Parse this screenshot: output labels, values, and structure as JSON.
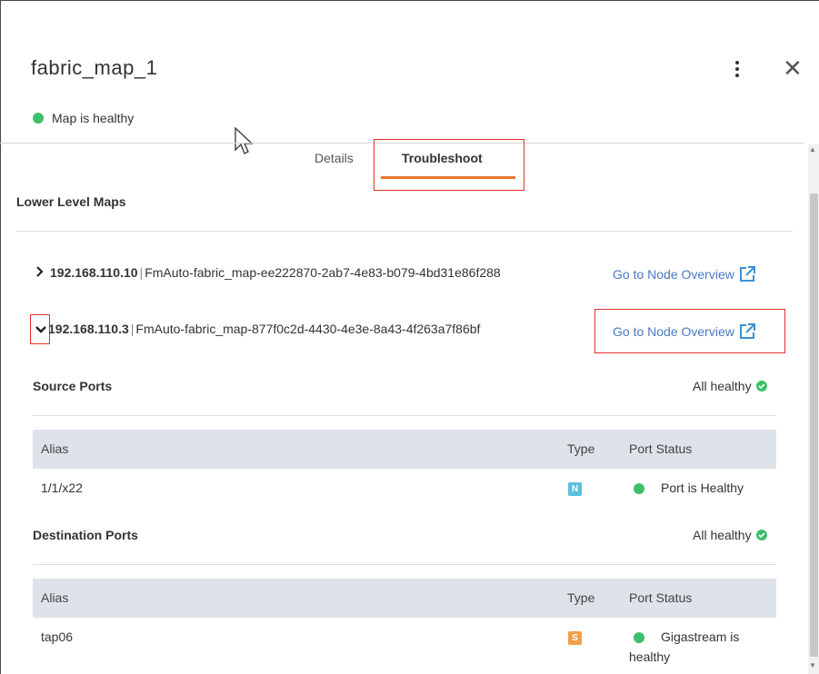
{
  "panel": {
    "title": "fabric_map_1",
    "status_text": "Map is healthy",
    "status_color": "#3dbf6b"
  },
  "tabs": [
    {
      "label": "Details",
      "active": false
    },
    {
      "label": "Troubleshoot",
      "active": true
    }
  ],
  "accent_color": "#e8762d",
  "lower_level_maps": {
    "title": "Lower Level Maps",
    "maps": [
      {
        "expanded": false,
        "chevron": "›",
        "ip": "192.168.110.10",
        "separator": "|",
        "name": "FmAuto-fabric_map-ee222870-2ab7-4e83-b079-4bd31e86f288",
        "link_label": "Go to Node Overview"
      },
      {
        "expanded": true,
        "chevron": "⌄",
        "ip": "192.168.110.3",
        "separator": "|",
        "name": "FmAuto-fabric_map-877f0c2d-4430-4e3e-8a43-4f263a7f86bf",
        "link_label": "Go to Node Overview"
      }
    ]
  },
  "source_ports": {
    "title": "Source Ports",
    "summary": "All healthy",
    "columns": [
      "Alias",
      "Type",
      "Port Status"
    ],
    "rows": [
      {
        "alias": "1/1/x22",
        "type": "N",
        "type_color": "#5bc0de",
        "status": "Port is Healthy"
      }
    ]
  },
  "destination_ports": {
    "title": "Destination Ports",
    "summary": "All healthy",
    "columns": [
      "Alias",
      "Type",
      "Port Status"
    ],
    "rows": [
      {
        "alias": "tap06",
        "type": "S",
        "type_color": "#f0a04b",
        "status_line1": "Gigastream is",
        "status_line2": "healthy"
      }
    ]
  },
  "icons": [
    "kebab-menu-icon",
    "close-icon",
    "external-link-icon",
    "check-icon",
    "status-dot-icon",
    "chevron-right-icon",
    "chevron-down-icon"
  ]
}
